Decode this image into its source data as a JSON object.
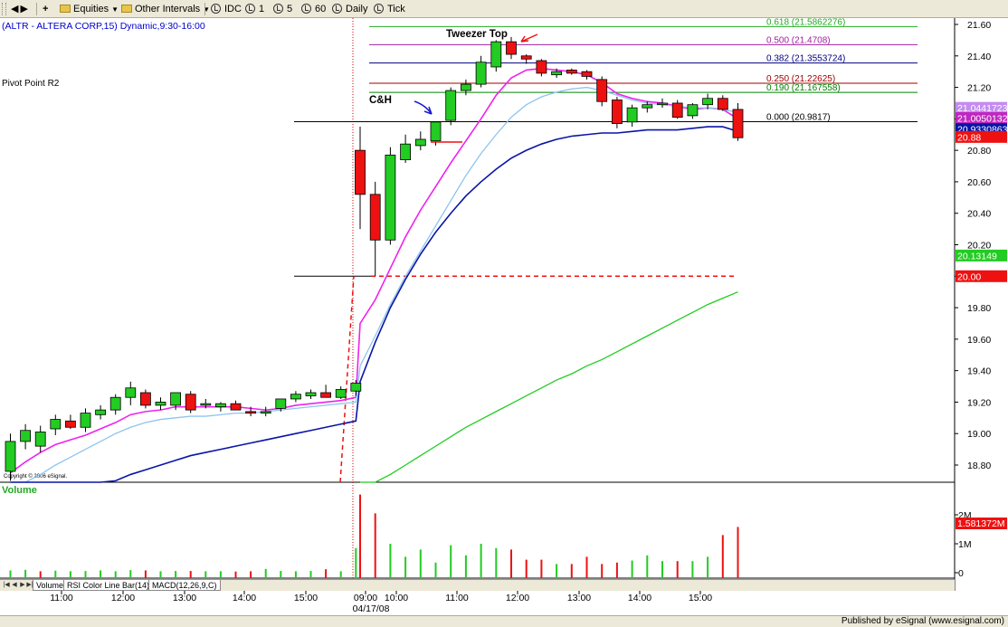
{
  "toolbar": {
    "equities": "Equities",
    "plus": "+",
    "other_intervals": "Other Intervals",
    "intervals": [
      "IDC",
      "1",
      "5",
      "60",
      "Daily",
      "Tick"
    ]
  },
  "chart_title": "(ALTR - ALTERA CORP,15) Dynamic,9:30-16:00",
  "pivot_label": "Pivot Point R2",
  "copyright": "Copyright © 2006 eSignal.",
  "annotations": {
    "tweezer": "Tweezer Top",
    "ch": "C&H"
  },
  "volume_label": "Volume",
  "tabs": [
    "Volume",
    "RSI Color Line Bar(14)",
    "MACD(12,26,9,C)"
  ],
  "status_text": "Published by eSignal (www.esignal.com)",
  "colors": {
    "up": "#22cc22",
    "down": "#ee1111",
    "ma_fast": "#ee22ee",
    "ma_light": "#8fc4f0",
    "ma_blue": "#0a14a6",
    "ma_green": "#22cc22",
    "fib_line": "#000000"
  },
  "chart_data": {
    "type": "candlestick",
    "price_axis": {
      "min": 18.7,
      "max": 21.64,
      "ticks": [
        "21.60",
        "21.40",
        "21.20",
        "21.00",
        "20.80",
        "20.60",
        "20.40",
        "20.20",
        "20.00",
        "19.80",
        "19.60",
        "19.40",
        "19.20",
        "19.00",
        "18.80"
      ]
    },
    "time_axis": {
      "labels": [
        "11:00",
        "12:00",
        "13:00",
        "14:00",
        "15:00",
        "09:00",
        "10:00",
        "11:00",
        "12:00",
        "13:00",
        "14:00",
        "15:00"
      ],
      "date_label": "04/17/08"
    },
    "price_tags": [
      {
        "text": "21.0441723",
        "value": 21.07,
        "bg": "#c58cf0",
        "fg": "#ffffff"
      },
      {
        "text": "21.0050132",
        "value": 21.005,
        "bg": "#c027c0",
        "fg": "#ffffff"
      },
      {
        "text": "20.9330863",
        "value": 20.935,
        "bg": "#0a14a6",
        "fg": "#ffffff"
      },
      {
        "text": "20.88",
        "value": 20.885,
        "bg": "#ee1111",
        "fg": "#ffffff"
      },
      {
        "text": "20.13149",
        "value": 20.1315,
        "bg": "#22cc22",
        "fg": "#ffffff"
      },
      {
        "text": "20.00",
        "value": 20.0,
        "bg": "#ee1111",
        "fg": "#ffffff"
      }
    ],
    "fib_levels": [
      {
        "label": "0.618 (21.5862276)",
        "value": 21.586,
        "color": "#22aa22"
      },
      {
        "label": "0.500 (21.4708)",
        "value": 21.471,
        "color": "#a020a0"
      },
      {
        "label": "0.382 (21.3553724)",
        "value": 21.355,
        "color": "#000080"
      },
      {
        "label": "0.250 (21.22625)",
        "value": 21.226,
        "color": "#a00000"
      },
      {
        "label": "0.190 (21.167558)",
        "value": 21.168,
        "color": "#008000"
      },
      {
        "label": "0.000 (20.9817)",
        "value": 20.982,
        "color": "#000000"
      }
    ],
    "pivot_r2": 20.0,
    "candles": [
      {
        "o": 18.76,
        "h": 19.0,
        "l": 18.7,
        "c": 18.95
      },
      {
        "o": 18.95,
        "h": 19.06,
        "l": 18.9,
        "c": 19.02
      },
      {
        "o": 18.92,
        "h": 19.05,
        "l": 18.88,
        "c": 19.01
      },
      {
        "o": 19.03,
        "h": 19.12,
        "l": 18.99,
        "c": 19.09
      },
      {
        "o": 19.08,
        "h": 19.12,
        "l": 19.03,
        "c": 19.04
      },
      {
        "o": 19.04,
        "h": 19.16,
        "l": 19.01,
        "c": 19.13
      },
      {
        "o": 19.12,
        "h": 19.18,
        "l": 19.09,
        "c": 19.15
      },
      {
        "o": 19.15,
        "h": 19.25,
        "l": 19.12,
        "c": 19.23
      },
      {
        "o": 19.23,
        "h": 19.33,
        "l": 19.18,
        "c": 19.29
      },
      {
        "o": 19.26,
        "h": 19.28,
        "l": 19.16,
        "c": 19.18
      },
      {
        "o": 19.18,
        "h": 19.23,
        "l": 19.15,
        "c": 19.2
      },
      {
        "o": 19.18,
        "h": 19.26,
        "l": 19.15,
        "c": 19.26
      },
      {
        "o": 19.25,
        "h": 19.27,
        "l": 19.13,
        "c": 19.15
      },
      {
        "o": 19.18,
        "h": 19.22,
        "l": 19.16,
        "c": 19.19
      },
      {
        "o": 19.17,
        "h": 19.2,
        "l": 19.14,
        "c": 19.19
      },
      {
        "o": 19.19,
        "h": 19.21,
        "l": 19.15,
        "c": 19.15
      },
      {
        "o": 19.14,
        "h": 19.17,
        "l": 19.11,
        "c": 19.13
      },
      {
        "o": 19.13,
        "h": 19.17,
        "l": 19.11,
        "c": 19.14
      },
      {
        "o": 19.16,
        "h": 19.22,
        "l": 19.14,
        "c": 19.22
      },
      {
        "o": 19.22,
        "h": 19.27,
        "l": 19.2,
        "c": 19.25
      },
      {
        "o": 19.24,
        "h": 19.28,
        "l": 19.22,
        "c": 19.26
      },
      {
        "o": 19.26,
        "h": 19.31,
        "l": 19.24,
        "c": 19.23
      },
      {
        "o": 19.23,
        "h": 19.3,
        "l": 19.22,
        "c": 19.28
      },
      {
        "o": 19.27,
        "h": 19.34,
        "l": 19.24,
        "c": 19.32
      },
      {
        "o": 20.8,
        "h": 20.95,
        "l": 20.3,
        "c": 20.52
      },
      {
        "o": 20.52,
        "h": 20.6,
        "l": 20.0,
        "c": 20.23
      },
      {
        "o": 20.23,
        "h": 20.82,
        "l": 20.2,
        "c": 20.77
      },
      {
        "o": 20.74,
        "h": 20.9,
        "l": 20.72,
        "c": 20.84
      },
      {
        "o": 20.83,
        "h": 20.92,
        "l": 20.8,
        "c": 20.87
      },
      {
        "o": 20.86,
        "h": 20.98,
        "l": 20.83,
        "c": 20.98
      },
      {
        "o": 20.99,
        "h": 21.2,
        "l": 20.96,
        "c": 21.18
      },
      {
        "o": 21.18,
        "h": 21.25,
        "l": 21.15,
        "c": 21.22
      },
      {
        "o": 21.22,
        "h": 21.4,
        "l": 21.2,
        "c": 21.36
      },
      {
        "o": 21.33,
        "h": 21.5,
        "l": 21.3,
        "c": 21.49
      },
      {
        "o": 21.49,
        "h": 21.52,
        "l": 21.38,
        "c": 21.41
      },
      {
        "o": 21.4,
        "h": 21.41,
        "l": 21.35,
        "c": 21.38
      },
      {
        "o": 21.37,
        "h": 21.38,
        "l": 21.27,
        "c": 21.29
      },
      {
        "o": 21.28,
        "h": 21.32,
        "l": 21.26,
        "c": 21.3
      },
      {
        "o": 21.31,
        "h": 21.32,
        "l": 21.28,
        "c": 21.29
      },
      {
        "o": 21.3,
        "h": 21.31,
        "l": 21.25,
        "c": 21.27
      },
      {
        "o": 21.25,
        "h": 21.27,
        "l": 21.08,
        "c": 21.11
      },
      {
        "o": 21.12,
        "h": 21.14,
        "l": 20.94,
        "c": 20.97
      },
      {
        "o": 20.98,
        "h": 21.09,
        "l": 20.95,
        "c": 21.07
      },
      {
        "o": 21.07,
        "h": 21.11,
        "l": 21.04,
        "c": 21.09
      },
      {
        "o": 21.09,
        "h": 21.13,
        "l": 21.07,
        "c": 21.1
      },
      {
        "o": 21.1,
        "h": 21.12,
        "l": 21.0,
        "c": 21.01
      },
      {
        "o": 21.02,
        "h": 21.1,
        "l": 21.0,
        "c": 21.09
      },
      {
        "o": 21.09,
        "h": 21.16,
        "l": 21.06,
        "c": 21.13
      },
      {
        "o": 21.13,
        "h": 21.15,
        "l": 21.05,
        "c": 21.06
      },
      {
        "o": 21.06,
        "h": 21.1,
        "l": 20.86,
        "c": 20.88
      }
    ],
    "moving_averages": [
      {
        "name": "",
        "color": "#ee22ee",
        "values": [
          18.75,
          18.82,
          18.88,
          18.93,
          18.96,
          18.99,
          19.03,
          19.07,
          19.12,
          19.14,
          19.15,
          19.17,
          19.17,
          19.17,
          19.17,
          19.17,
          19.16,
          19.15,
          19.16,
          19.18,
          19.19,
          19.2,
          19.21,
          19.23,
          19.7,
          19.85,
          20.05,
          20.25,
          20.42,
          20.57,
          20.72,
          20.86,
          21.0,
          21.15,
          21.26,
          21.31,
          21.32,
          21.31,
          21.3,
          21.28,
          21.23,
          21.16,
          21.13,
          21.11,
          21.1,
          21.08,
          21.06,
          21.07,
          21.06,
          21.0
        ]
      },
      {
        "name": "",
        "color": "#8fc4f0",
        "values": [
          18.63,
          18.68,
          18.74,
          18.8,
          18.85,
          18.9,
          18.95,
          19.0,
          19.04,
          19.07,
          19.09,
          19.1,
          19.11,
          19.11,
          19.12,
          19.13,
          19.13,
          19.14,
          19.15,
          19.16,
          19.17,
          19.18,
          19.19,
          19.2,
          19.43,
          19.62,
          19.82,
          20.0,
          20.16,
          20.32,
          20.48,
          20.64,
          20.78,
          20.9,
          21.01,
          21.09,
          21.14,
          21.17,
          21.19,
          21.2,
          21.18,
          21.15,
          21.12,
          21.1,
          21.09,
          21.08,
          21.07,
          21.07,
          21.06,
          21.04
        ]
      },
      {
        "name": "",
        "color": "#0a14a6",
        "values": [
          18.3,
          18.35,
          18.42,
          18.49,
          18.55,
          18.6,
          18.65,
          18.7,
          18.74,
          18.77,
          18.8,
          18.83,
          18.86,
          18.88,
          18.9,
          18.92,
          18.94,
          18.96,
          18.98,
          19.0,
          19.02,
          19.04,
          19.06,
          19.08,
          19.33,
          19.58,
          19.8,
          19.98,
          20.14,
          20.28,
          20.4,
          20.51,
          20.6,
          20.68,
          20.75,
          20.8,
          20.84,
          20.87,
          20.89,
          20.9,
          20.91,
          20.91,
          20.92,
          20.93,
          20.93,
          20.93,
          20.94,
          20.95,
          20.95,
          20.92
        ]
      },
      {
        "name": "",
        "color": "#22cc22",
        "values": [
          null,
          null,
          null,
          null,
          null,
          null,
          null,
          null,
          null,
          null,
          null,
          null,
          null,
          null,
          null,
          null,
          null,
          null,
          null,
          null,
          null,
          null,
          null,
          null,
          18.62,
          18.68,
          18.74,
          18.8,
          18.86,
          18.92,
          18.98,
          19.04,
          19.09,
          19.14,
          19.19,
          19.24,
          19.29,
          19.34,
          19.38,
          19.43,
          19.47,
          19.52,
          19.57,
          19.62,
          19.67,
          19.72,
          19.77,
          19.82,
          19.86,
          19.9
        ]
      }
    ],
    "volume": {
      "ticks": [
        "2M",
        "1M",
        "0"
      ],
      "last_label": "1.581372M",
      "values": [
        0.08,
        0.1,
        0.05,
        0.07,
        0.05,
        0.06,
        0.08,
        0.05,
        0.09,
        0.08,
        0.05,
        0.06,
        0.06,
        0.05,
        0.05,
        0.04,
        0.05,
        0.13,
        0.06,
        0.05,
        0.06,
        0.12,
        0.05,
        0.85,
        2.7,
        2.05,
        1.0,
        0.55,
        0.8,
        0.35,
        0.95,
        0.6,
        1.0,
        0.85,
        0.8,
        0.45,
        0.45,
        0.3,
        0.3,
        0.55,
        0.3,
        0.35,
        0.42,
        0.6,
        0.4,
        0.4,
        0.4,
        0.55,
        1.3,
        1.58
      ],
      "colors": [
        "up",
        "up",
        "down",
        "up",
        "up",
        "up",
        "up",
        "up",
        "up",
        "down",
        "up",
        "up",
        "down",
        "up",
        "up",
        "down",
        "down",
        "up",
        "up",
        "up",
        "up",
        "down",
        "up",
        "up",
        "down",
        "down",
        "up",
        "up",
        "up",
        "up",
        "up",
        "up",
        "up",
        "up",
        "down",
        "down",
        "down",
        "up",
        "down",
        "down",
        "down",
        "down",
        "up",
        "up",
        "up",
        "down",
        "up",
        "up",
        "down",
        "down"
      ]
    }
  }
}
